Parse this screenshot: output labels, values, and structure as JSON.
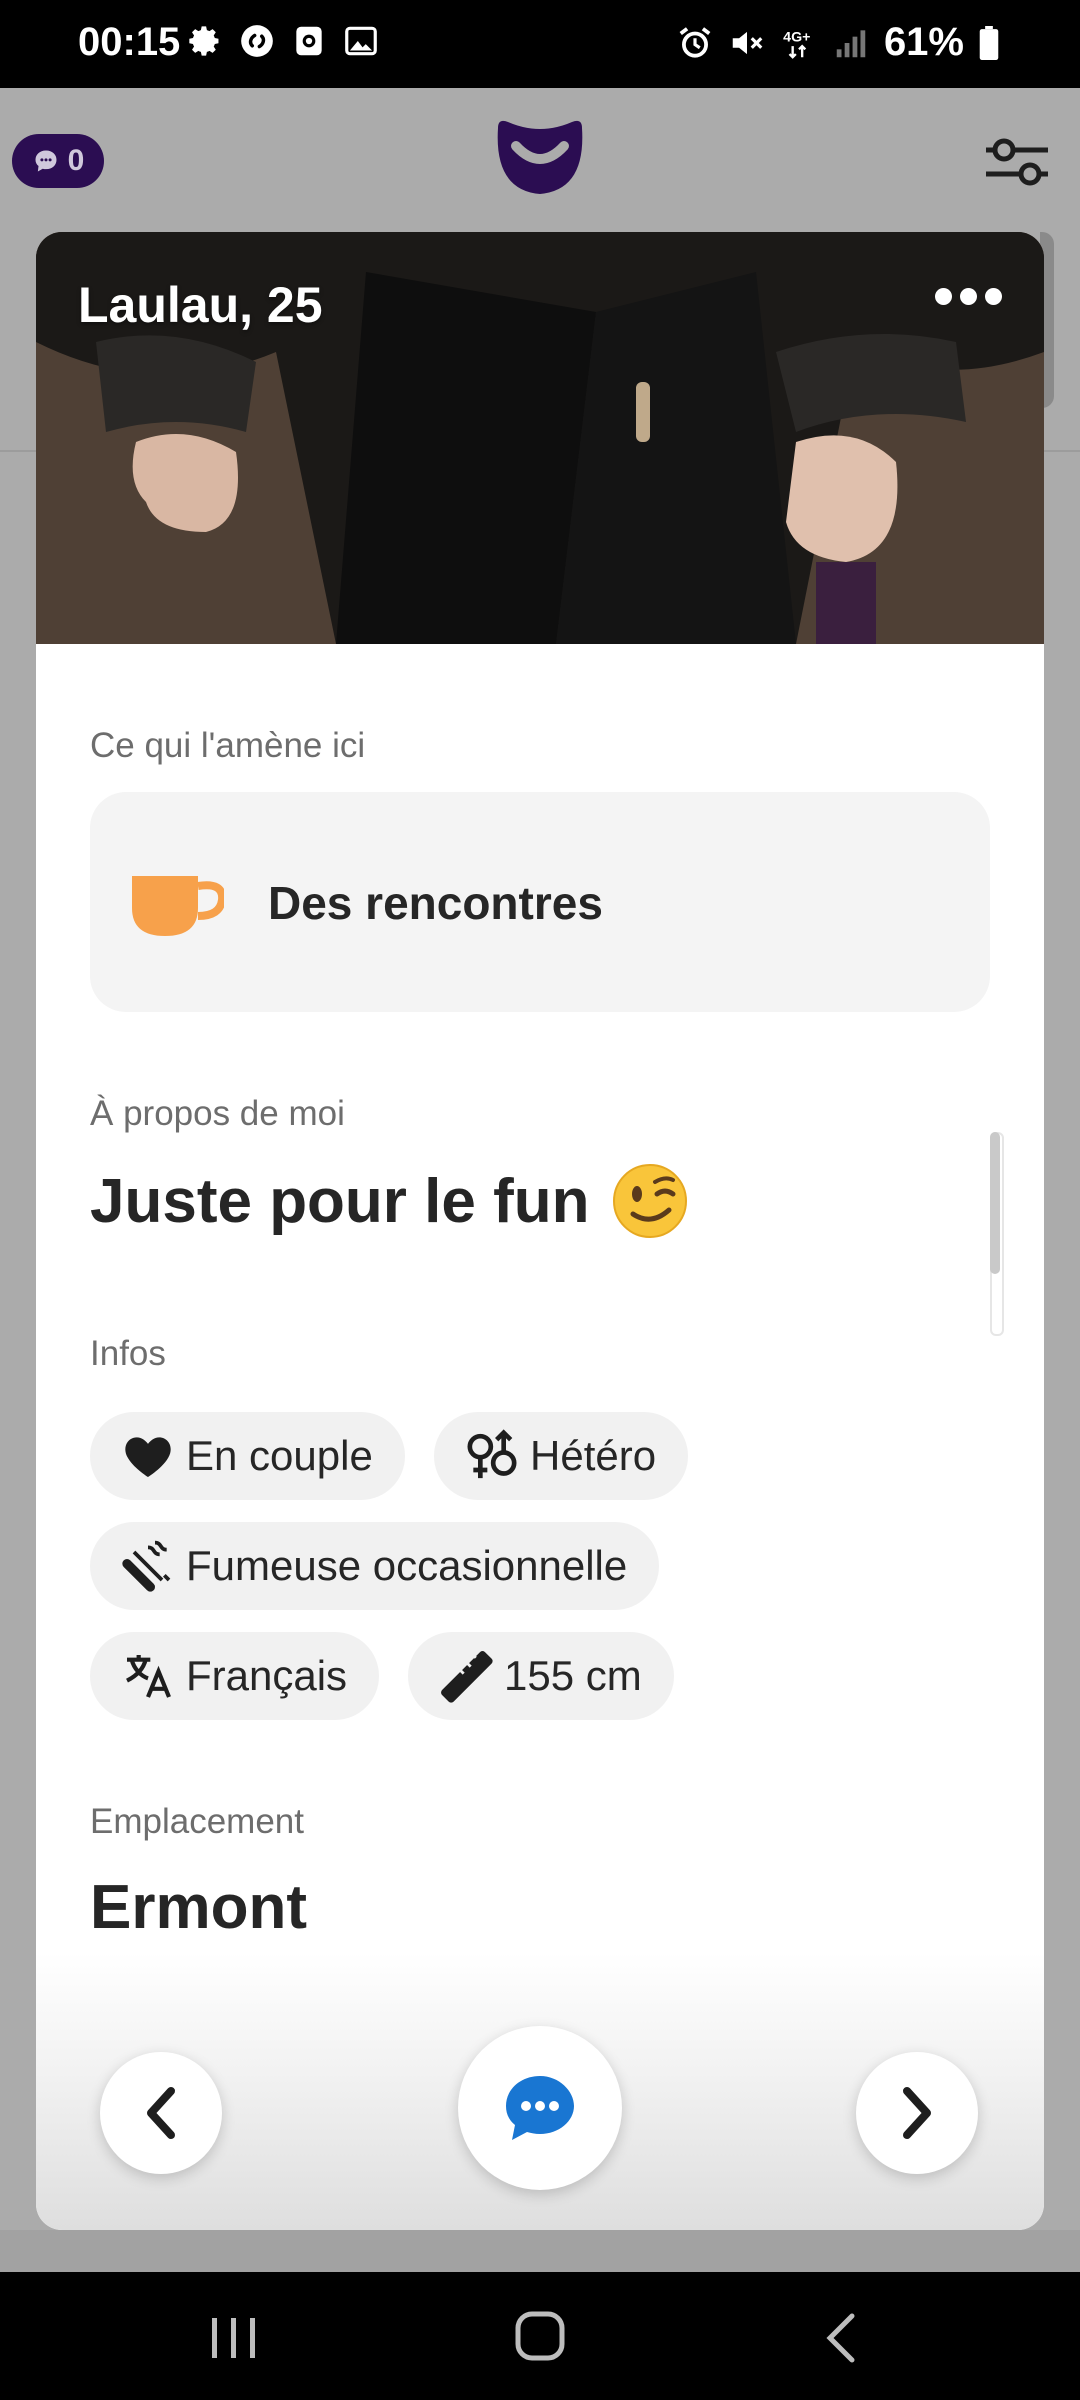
{
  "status_bar": {
    "time": "00:15",
    "battery": "61%",
    "network": "4G+",
    "left_icons": [
      "settings-icon",
      "shazam-icon",
      "screen-record-icon",
      "gallery-icon"
    ],
    "right_icons": [
      "alarm-icon",
      "mute-icon",
      "network-4g-icon",
      "signal-icon",
      "battery-icon"
    ]
  },
  "header": {
    "messages_count": "0",
    "logo_icon": "smile-logo-icon",
    "filter_icon": "sliders-icon",
    "brand_color": "#2b0d52"
  },
  "profile": {
    "name_age": "Laulau, 25",
    "purpose_label": "Ce qui l'amène ici",
    "purpose_value": "Des rencontres",
    "purpose_icon": "coffee-cup-icon",
    "about_label": "À propos de moi",
    "about_text": "Juste pour le fun",
    "about_emoji": "winking-face-emoji",
    "infos_label": "Infos",
    "infos": [
      {
        "icon": "heart-icon",
        "label": "En couple"
      },
      {
        "icon": "gender-icon",
        "label": "Hétéro"
      },
      {
        "icon": "smoking-icon",
        "label": "Fumeuse occasionnelle"
      },
      {
        "icon": "translate-icon",
        "label": "Français"
      },
      {
        "icon": "ruler-icon",
        "label": "155 cm"
      }
    ],
    "location_label": "Emplacement",
    "location_value": "Ermont"
  },
  "actions": {
    "prev_icon": "chevron-left-icon",
    "chat_icon": "chat-bubble-icon",
    "next_icon": "chevron-right-icon",
    "chat_color": "#1976d2",
    "purpose_icon_color": "#f7a14b"
  },
  "system_nav": {
    "icons": [
      "recent-apps-icon",
      "home-icon",
      "back-icon"
    ]
  }
}
